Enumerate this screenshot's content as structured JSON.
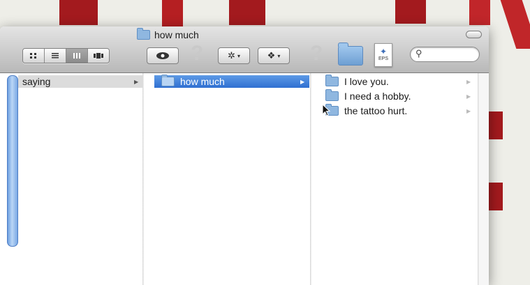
{
  "window": {
    "title": "how much"
  },
  "toolbar": {
    "view_buttons": [
      "icon-view",
      "list-view",
      "column-view",
      "cover-flow-view"
    ],
    "active_view": "column-view",
    "quicklook_icon": "eye-icon",
    "action_icon": "gear-icon",
    "dropbox_icon": "dropbox-icon",
    "help_icon": "question-mark-icon",
    "search": {
      "value": "",
      "placeholder": ""
    },
    "eps_label": "EPS"
  },
  "columns": {
    "col1": {
      "items": [
        {
          "name": "saying",
          "selected": false,
          "highlighted": true
        }
      ]
    },
    "col2": {
      "items": [
        {
          "name": "how much",
          "selected": true
        }
      ]
    },
    "col3": {
      "items": [
        {
          "name": "I love you."
        },
        {
          "name": "I need a hobby."
        },
        {
          "name": "the tattoo hurt."
        }
      ]
    }
  },
  "colors": {
    "selection": "#2f6fd1",
    "folder": "#8fb7e0",
    "desktop_accent": "#a31a1e"
  }
}
